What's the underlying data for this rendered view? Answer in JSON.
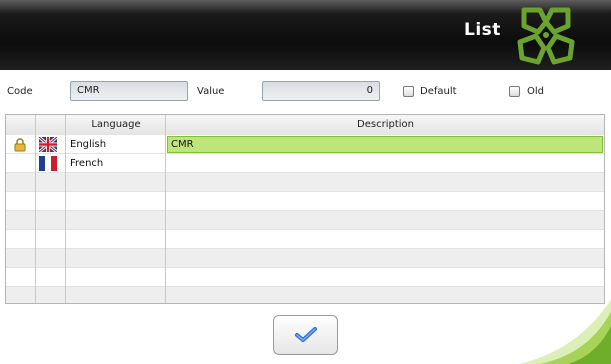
{
  "header": {
    "title": "List"
  },
  "form": {
    "code_label": "Code",
    "code_value": "CMR",
    "value_label": "Value",
    "value_value": "0",
    "default_label": "Default",
    "default_checked": false,
    "old_label": "Old",
    "old_checked": false
  },
  "grid": {
    "columns": [
      "Language",
      "Description"
    ],
    "rows": [
      {
        "locked": true,
        "flag": "uk-flag-icon",
        "language": "English",
        "description": "CMR",
        "selected": true
      },
      {
        "locked": false,
        "flag": "france-flag-icon",
        "language": "French",
        "description": "",
        "selected": false
      }
    ],
    "empty_rows": 7
  },
  "footer": {
    "ok_icon": "checkmark-icon"
  },
  "colors": {
    "header_bg": "#111111",
    "accent_green": "#8cc63f",
    "selected_cell": "#bfe57a",
    "check_blue": "#2f6fd0"
  }
}
